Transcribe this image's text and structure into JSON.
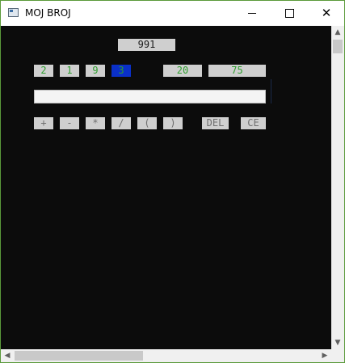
{
  "window": {
    "title": "MOJ BROJ"
  },
  "game": {
    "target": "991",
    "numbers": [
      "2",
      "1",
      "9",
      "3",
      "20",
      "75"
    ],
    "selected_number": "3",
    "expression": "",
    "operators": [
      "+",
      "-",
      "*",
      "/",
      "(",
      ")"
    ],
    "del_label": "DEL",
    "ce_label": "CE"
  },
  "colors": {
    "background": "#0c0c0c",
    "cell": "#cfcfcf",
    "number_text": "#2f9e2f",
    "selected": "#0a30c8",
    "operator_text": "#6f6f6f"
  },
  "icons": {
    "minimize": "minimize-icon",
    "maximize": "maximize-icon",
    "close": "close-icon",
    "scroll_up": "chevron-up-icon",
    "scroll_down": "chevron-down-icon",
    "scroll_left": "chevron-left-icon",
    "scroll_right": "chevron-right-icon"
  },
  "glyphs": {
    "up": "▲",
    "down": "▼",
    "left": "◀",
    "right": "▶",
    "close": "✕"
  }
}
